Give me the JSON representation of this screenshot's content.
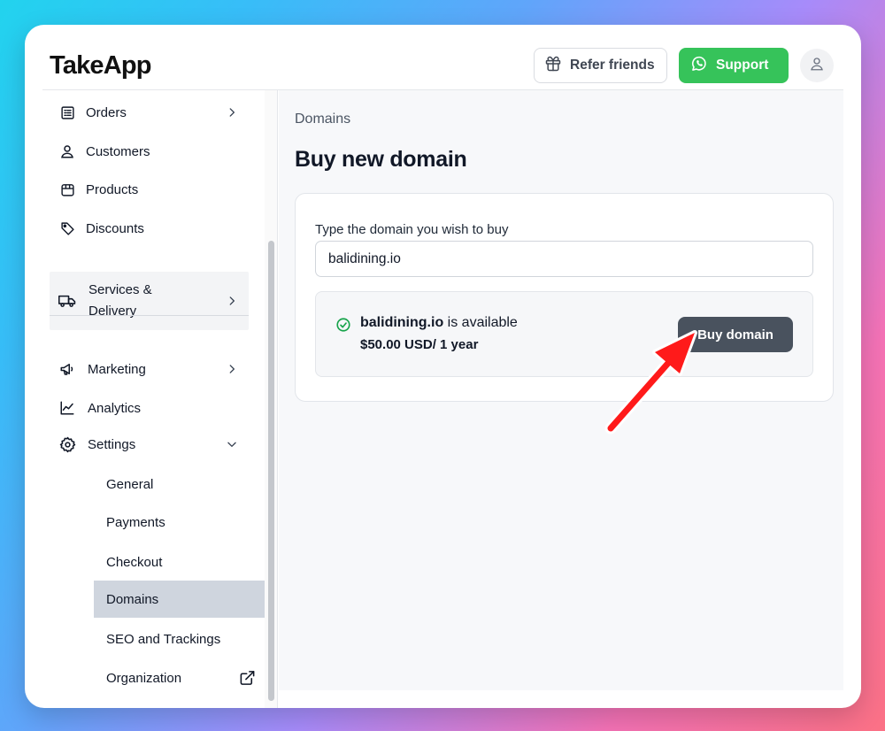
{
  "app": {
    "logo": "TakeApp"
  },
  "header": {
    "refer_label": "Refer friends",
    "support_label": "Support",
    "support_color": "#36c35a"
  },
  "sidebar": {
    "items": [
      {
        "label": "Orders",
        "icon": "orders-list-icon"
      },
      {
        "label": "Customers",
        "icon": "user-icon"
      },
      {
        "label": "Products",
        "icon": "box-icon"
      },
      {
        "label": "Discounts",
        "icon": "tag-icon"
      },
      {
        "label": "Services & Delivery",
        "icon": "truck-icon"
      },
      {
        "label": "Marketing",
        "icon": "megaphone-icon"
      },
      {
        "label": "Analytics",
        "icon": "chart-line-icon"
      },
      {
        "label": "Settings",
        "icon": "gear-icon"
      }
    ],
    "settings_sub": [
      {
        "label": "General"
      },
      {
        "label": "Payments"
      },
      {
        "label": "Checkout"
      },
      {
        "label": "Domains",
        "active": true
      },
      {
        "label": "SEO and Trackings"
      },
      {
        "label": "Organization",
        "icon": "external-link-icon"
      }
    ]
  },
  "main": {
    "breadcrumb": "Domains",
    "title": "Buy new domain",
    "field_label": "Type the domain you wish to buy",
    "domain_value": "balidining.io",
    "availability": {
      "domain": "balidining.io",
      "status_text": " is available",
      "price": "$50.00 USD/ 1 year",
      "buy_label": "Buy domain"
    }
  },
  "annotation": {
    "arrow_color": "#ff1a1a"
  }
}
